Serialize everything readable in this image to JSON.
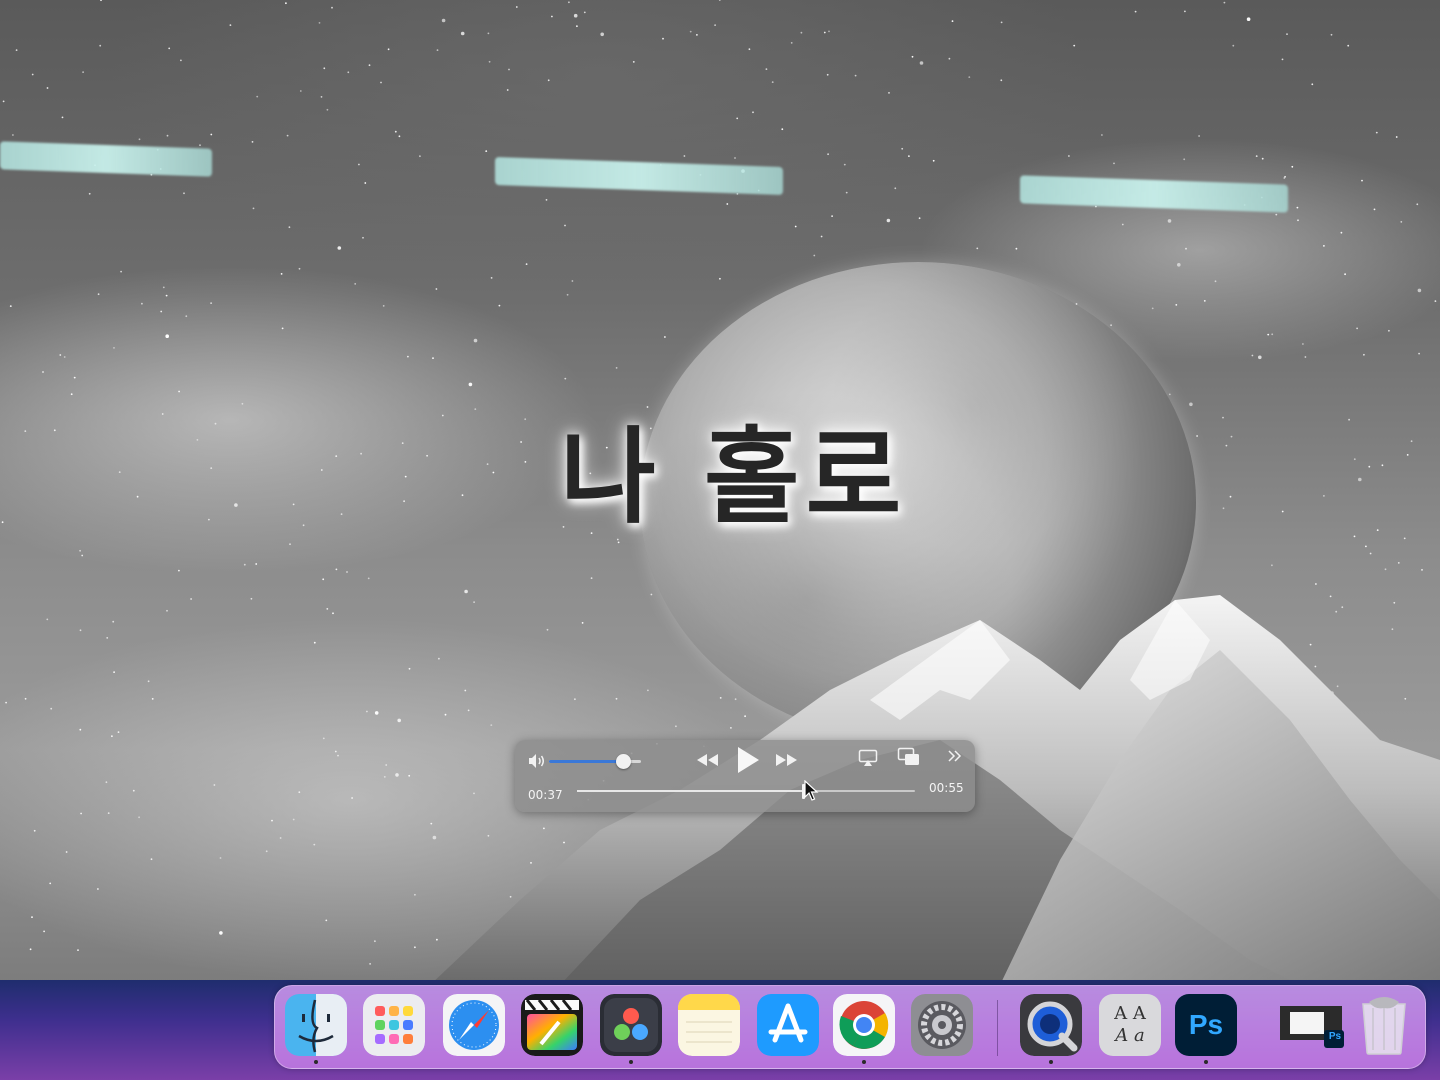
{
  "video": {
    "title_text": "나 홀로"
  },
  "player": {
    "volume_level": 0.8,
    "current_time": "00:37",
    "remaining_time": "00:55",
    "progress": 0.67,
    "icons": [
      "speaker-icon",
      "rewind-icon",
      "play-icon",
      "fast-forward-icon",
      "airplay-icon",
      "picture-in-picture-icon",
      "more-chevron-icon"
    ]
  },
  "dock": {
    "items": [
      {
        "name": "finder",
        "icon": "finder-icon"
      },
      {
        "name": "launchpad",
        "icon": "launchpad-icon"
      },
      {
        "name": "safari",
        "icon": "safari-icon"
      },
      {
        "name": "final-cut-pro",
        "icon": "final-cut-pro-icon"
      },
      {
        "name": "davinci-resolve",
        "icon": "davinci-resolve-icon"
      },
      {
        "name": "notes",
        "icon": "notes-icon"
      },
      {
        "name": "app-store",
        "icon": "app-store-icon"
      },
      {
        "name": "chrome",
        "icon": "chrome-icon"
      },
      {
        "name": "system-settings",
        "icon": "system-settings-icon"
      },
      {
        "name": "quicktime-player",
        "icon": "quicktime-icon"
      },
      {
        "name": "font-book",
        "icon": "font-book-icon",
        "label_top": "A A",
        "label_bottom": "A a"
      },
      {
        "name": "photoshop",
        "icon": "photoshop-icon",
        "label": "Ps"
      },
      {
        "name": "photoshop-window",
        "icon": "minimized-window-icon",
        "badge": "Ps"
      },
      {
        "name": "trash",
        "icon": "trash-icon"
      }
    ]
  }
}
